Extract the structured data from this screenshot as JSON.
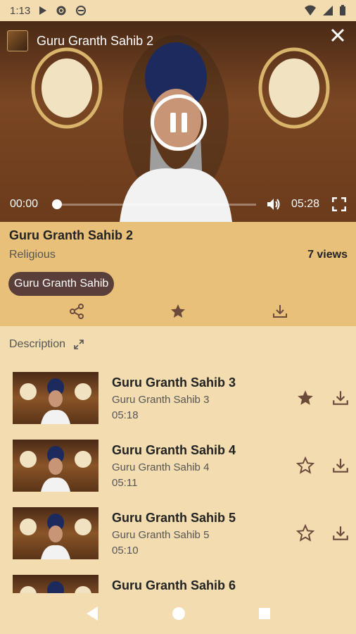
{
  "status": {
    "time": "1:13"
  },
  "player": {
    "title": "Guru Granth Sahib 2",
    "current_time": "00:00",
    "duration": "05:28",
    "progress": 0
  },
  "video": {
    "title": "Guru Granth Sahib 2",
    "category": "Religious",
    "views": "7 views",
    "tag": "Guru Granth Sahib"
  },
  "description_label": "Description",
  "related": [
    {
      "title": "Guru Granth Sahib 3",
      "subtitle": "Guru Granth Sahib 3",
      "duration": "05:18",
      "favorite": true
    },
    {
      "title": "Guru Granth Sahib 4",
      "subtitle": "Guru Granth Sahib 4",
      "duration": "05:11",
      "favorite": false
    },
    {
      "title": "Guru Granth Sahib 5",
      "subtitle": "Guru Granth Sahib 5",
      "duration": "05:10",
      "favorite": false
    },
    {
      "title": "Guru Granth Sahib 6",
      "subtitle": "",
      "duration": "",
      "favorite": false
    }
  ],
  "icons": {
    "share": "share-icon",
    "favorite": "star-icon",
    "download": "download-icon",
    "expand": "expand-icon",
    "back": "back-icon",
    "home": "home-icon",
    "recents": "recents-icon"
  },
  "colors": {
    "background": "#f3ddb0",
    "info_panel": "#e9c07a",
    "tag": "#5a3e39",
    "icon": "#6b4a3a"
  }
}
